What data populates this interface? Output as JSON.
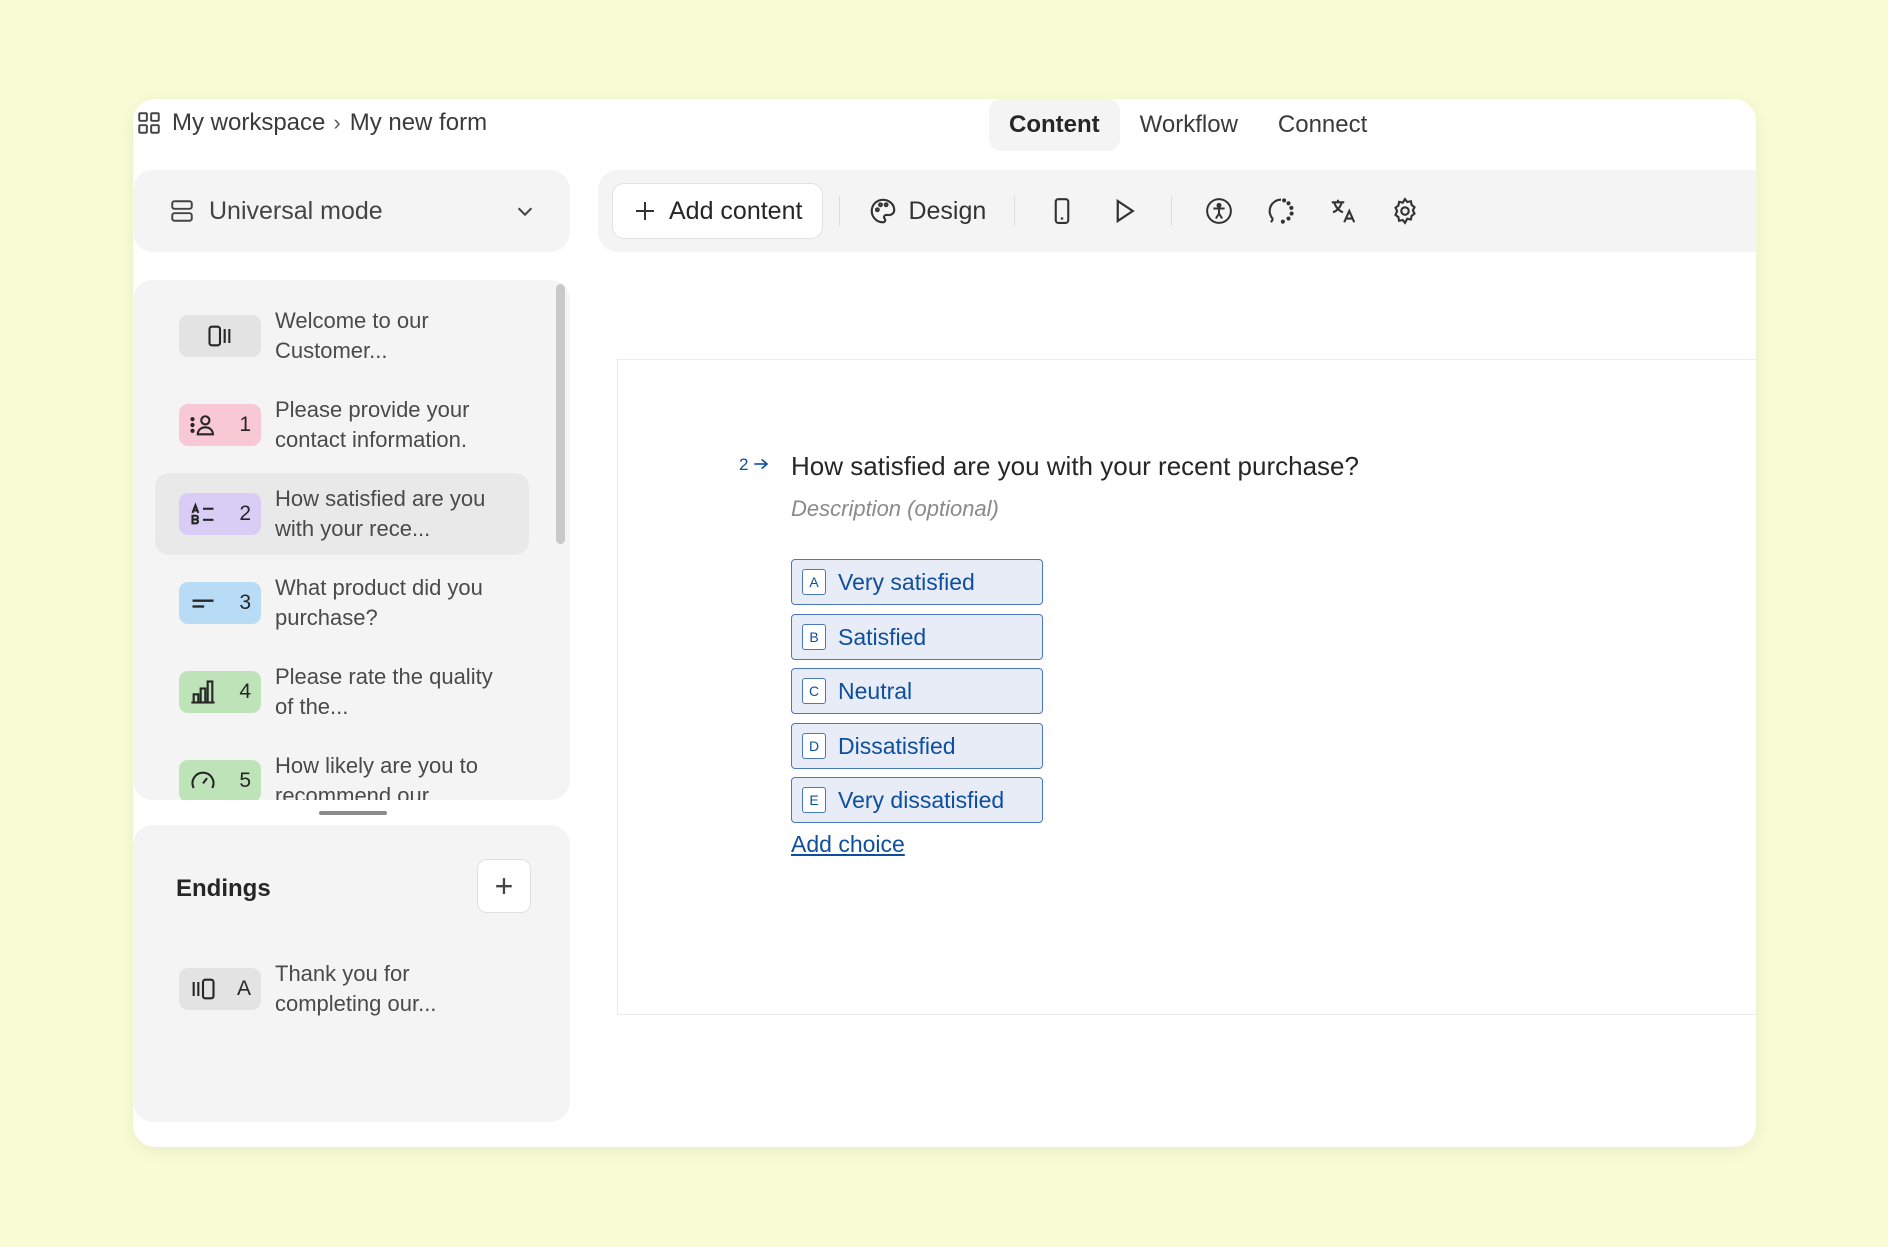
{
  "breadcrumb": {
    "workspace": "My workspace",
    "separator": "›",
    "form": "My new form"
  },
  "tabs": [
    {
      "label": "Content",
      "active": true
    },
    {
      "label": "Workflow",
      "active": false
    },
    {
      "label": "Connect",
      "active": false
    }
  ],
  "mode": {
    "label": "Universal mode"
  },
  "toolbar": {
    "add_content": "Add content",
    "design": "Design",
    "icons": [
      "mobile-preview-icon",
      "play-icon",
      "accessibility-icon",
      "loading-icon",
      "translate-icon",
      "settings-icon"
    ]
  },
  "questions": [
    {
      "number": "",
      "text": "Welcome to our Customer...",
      "icon": "welcome-screen-icon",
      "color": "#e3e3e4"
    },
    {
      "number": "1",
      "text": "Please provide your contact information.",
      "icon": "contact-info-icon",
      "color": "#f8c8d4"
    },
    {
      "number": "2",
      "text": "How satisfied are you with your rece...",
      "icon": "multiple-choice-icon",
      "color": "#d9cdf5",
      "selected": true
    },
    {
      "number": "3",
      "text": "What product did you purchase?",
      "icon": "short-text-icon",
      "color": "#b9dcf6"
    },
    {
      "number": "4",
      "text": "Please rate the quality of the...",
      "icon": "rating-bars-icon",
      "color": "#bfe3b9"
    },
    {
      "number": "5",
      "text": "How likely are you to recommend our",
      "icon": "nps-gauge-icon",
      "color": "#bfe3b9"
    }
  ],
  "endings": {
    "title": "Endings",
    "add": "+",
    "items": [
      {
        "letter": "A",
        "text": "Thank you for completing our...",
        "icon": "ending-screen-icon",
        "color": "#e3e3e4"
      }
    ]
  },
  "question": {
    "number": "2",
    "title": "How satisfied are you with your recent purchase?",
    "description": "Description (optional)",
    "choices": [
      {
        "key": "A",
        "label": "Very satisfied"
      },
      {
        "key": "B",
        "label": "Satisfied"
      },
      {
        "key": "C",
        "label": "Neutral"
      },
      {
        "key": "D",
        "label": "Dissatisfied"
      },
      {
        "key": "E",
        "label": "Very dissatisfied"
      }
    ],
    "add_choice": "Add choice"
  }
}
